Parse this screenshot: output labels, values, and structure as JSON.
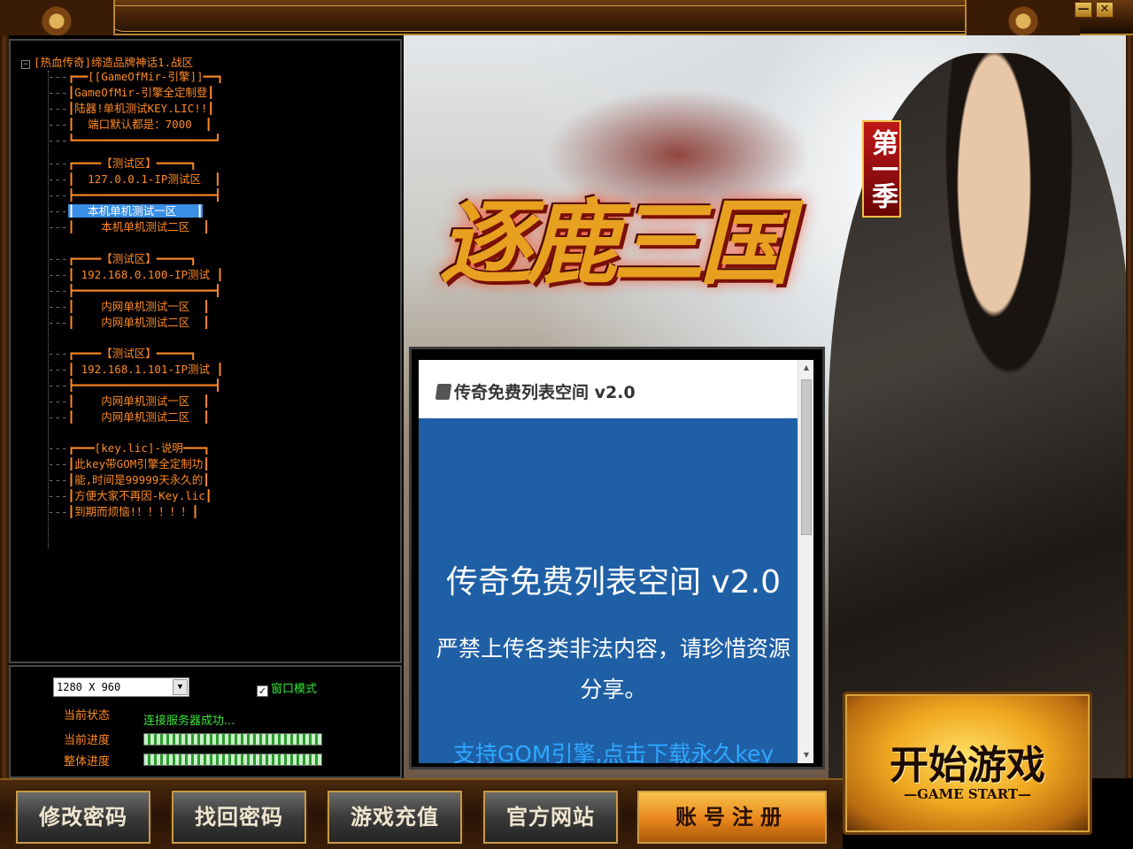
{
  "window": {
    "minimize_label": "—",
    "close_label": "✕"
  },
  "server_tree": {
    "root_label": "[热血传奇]缔造品牌神话1.战区",
    "items": [
      {
        "text": "┏━━[[GameOfMir-引擎]]━━┓",
        "selected": false
      },
      {
        "text": "┃GameOfMir-引擎全定制登┃",
        "selected": false
      },
      {
        "text": "┃陆器!单机测试KEY.LIC!!┃",
        "selected": false
      },
      {
        "text": "┃  端口默认都是：7000  ┃",
        "selected": false
      },
      {
        "text": "┗━━━━━━━━━━━━━━━━━━━━━┛",
        "selected": false
      },
      {
        "text": "┏━━━━【测试区】━━━━━┓",
        "selected": false
      },
      {
        "text": "┃  127.0.0.1-IP测试区  ┃",
        "selected": false
      },
      {
        "text": "┣━━━━━━━━━━━━━━━━━━━━━┫",
        "selected": false
      },
      {
        "text": "┃  本机单机测试一区   ┃",
        "selected": true
      },
      {
        "text": "┃    本机单机测试二区  ┃",
        "selected": false
      },
      {
        "text": "┏━━━━【测试区】━━━━━┓",
        "selected": false
      },
      {
        "text": "┃ 192.168.0.100-IP测试 ┃",
        "selected": false
      },
      {
        "text": "┣━━━━━━━━━━━━━━━━━━━━━┫",
        "selected": false
      },
      {
        "text": "┃    内网单机测试一区  ┃",
        "selected": false
      },
      {
        "text": "┃    内网单机测试二区  ┃",
        "selected": false
      },
      {
        "text": "┏━━━━【测试区】━━━━━┓",
        "selected": false
      },
      {
        "text": "┃ 192.168.1.101-IP测试 ┃",
        "selected": false
      },
      {
        "text": "┣━━━━━━━━━━━━━━━━━━━━━┫",
        "selected": false
      },
      {
        "text": "┃    内网单机测试一区  ┃",
        "selected": false
      },
      {
        "text": "┃    内网单机测试二区  ┃",
        "selected": false
      },
      {
        "text": "┏━━━[key.lic]-说明━━━┓",
        "selected": false
      },
      {
        "text": "┃此key带GOM引擎全定制功┃",
        "selected": false
      },
      {
        "text": "┃能,时间是99999天永久的┃",
        "selected": false
      },
      {
        "text": "┃方便大家不再因-Key.lic┃",
        "selected": false
      },
      {
        "text": "┃到期而烦恼!！！！！！┃",
        "selected": false
      }
    ]
  },
  "settings": {
    "resolution": "1280 X 960",
    "windowed_label": "窗口模式",
    "windowed_checked": true,
    "status_label": "当前状态",
    "status_value": "连接服务器成功...",
    "current_progress_label": "当前进度",
    "overall_progress_label": "整体进度",
    "current_progress": 1.0,
    "overall_progress": 1.0
  },
  "art": {
    "game_title": "逐鹿三国",
    "season_badge": "第一季"
  },
  "news": {
    "header": "传奇免费列表空间 v2.0",
    "title": "传奇免费列表空间 v2.0",
    "description": "严禁上传各类非法内容，请珍惜资源分享。",
    "link": "支持GOM引擎,点击下载永久key"
  },
  "start_button": {
    "label_cn": "开始游戏",
    "label_en": "—GAME START—"
  },
  "bottom_buttons": {
    "change_password": "修改密码",
    "recover_password": "找回密码",
    "recharge": "游戏充值",
    "official_site": "官方网站",
    "register": "账号注册"
  },
  "icons": {
    "expander": "minus-box-icon",
    "dropdown": "chevron-down-icon",
    "checkbox": "checkmark-icon",
    "doc": "document-icon"
  }
}
